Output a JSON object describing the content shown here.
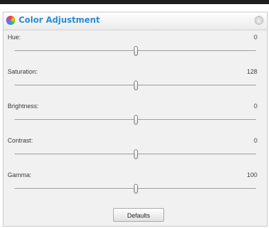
{
  "window": {
    "title": "Color Adjustment",
    "close_icon": "x"
  },
  "sliders": [
    {
      "label": "Hue:",
      "value": "0"
    },
    {
      "label": "Saturation:",
      "value": "128"
    },
    {
      "label": "Brightness:",
      "value": "0"
    },
    {
      "label": "Contrast:",
      "value": "0"
    },
    {
      "label": "Gamma:",
      "value": "100"
    }
  ],
  "buttons": {
    "defaults_label": "Defaults"
  },
  "colors": {
    "title_text": "#2a8cd6",
    "panel_background": "#f1f1f1"
  }
}
